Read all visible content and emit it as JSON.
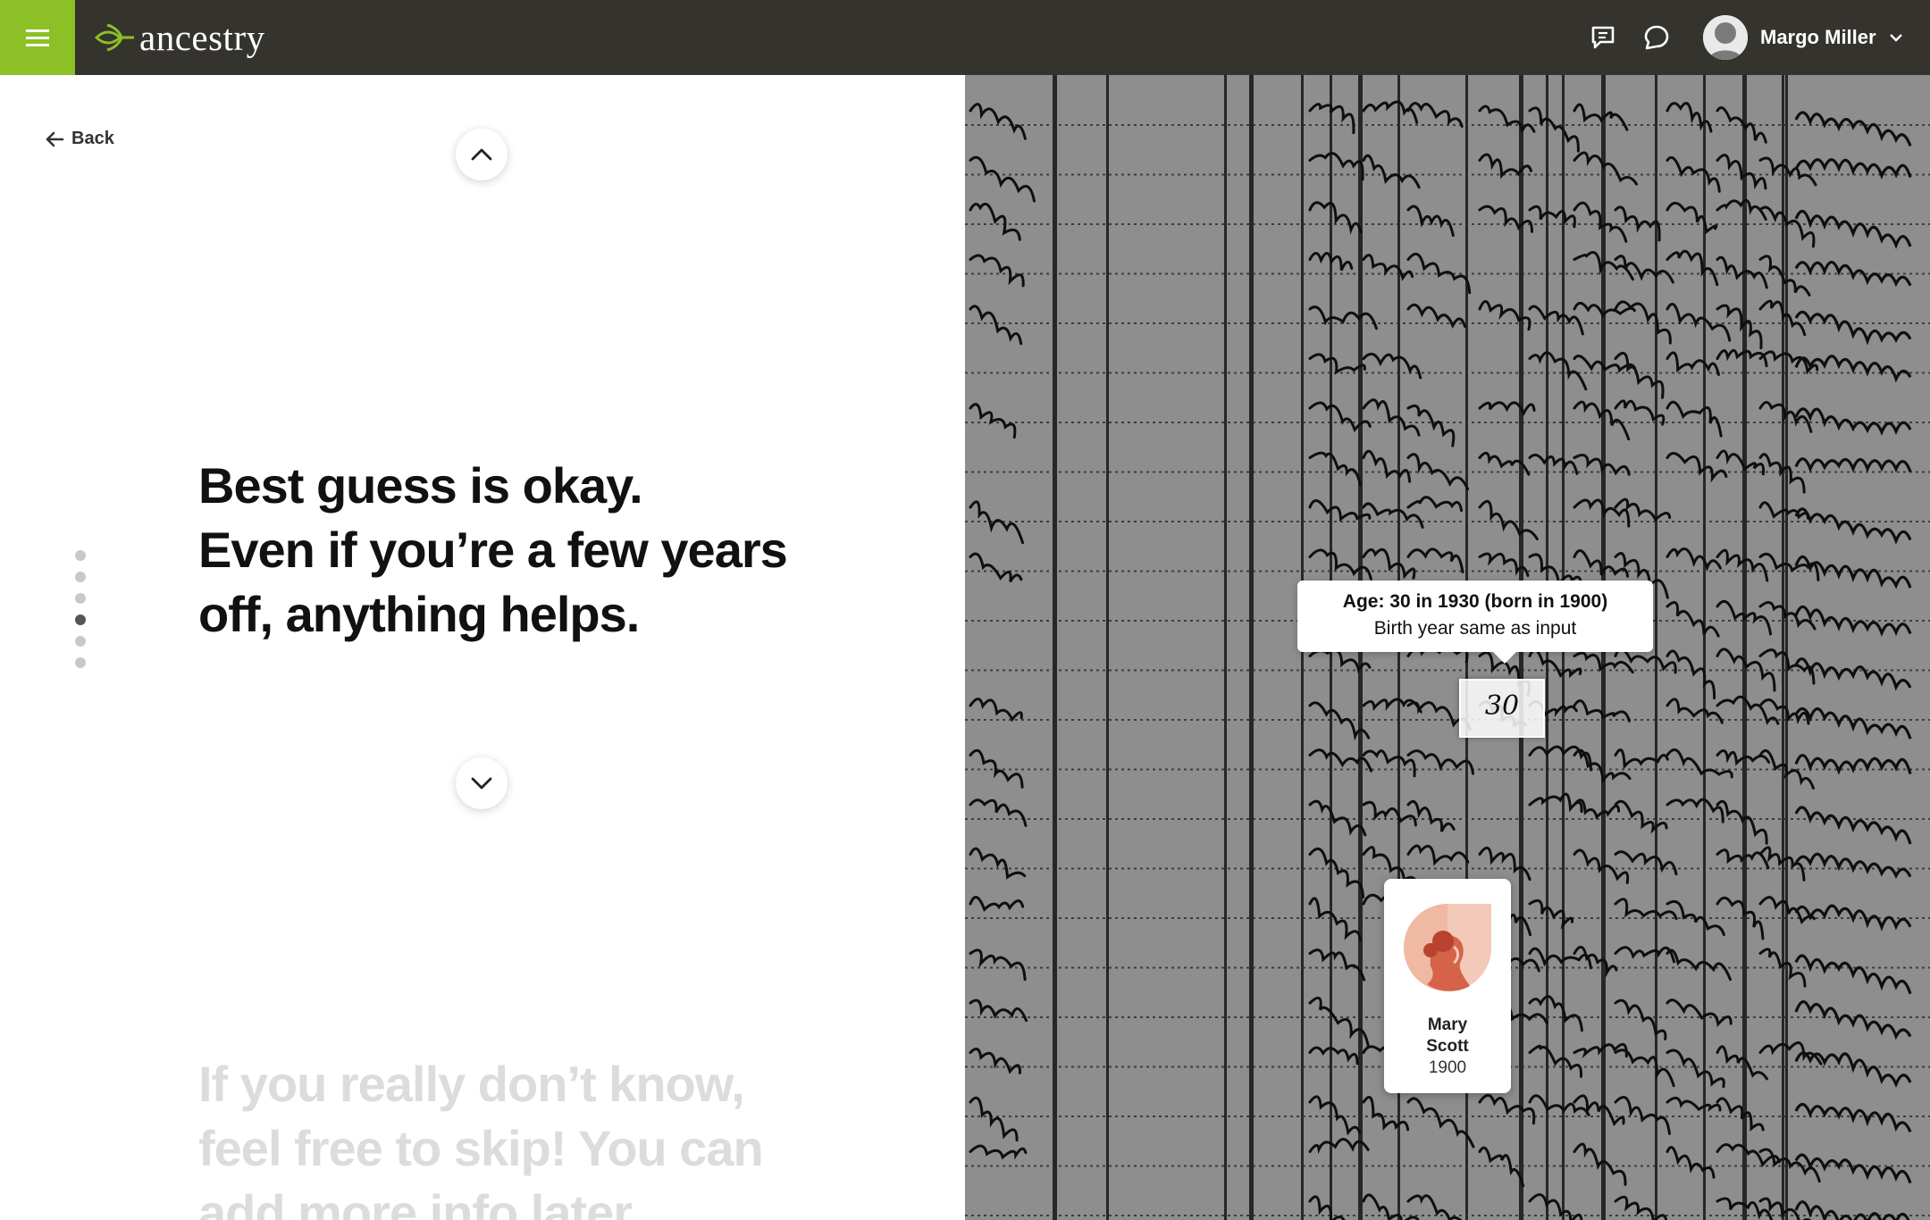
{
  "header": {
    "logo_text": "ancestry",
    "menu_icon": "hamburger-icon",
    "message_icon": "message-icon",
    "chat_icon": "chat-bubble-icon",
    "user_name": "Margo Miller",
    "user_menu_icon": "chevron-down-icon",
    "brand_color": "#8dbf26",
    "bar_color": "#35332e"
  },
  "nav": {
    "back_label": "Back"
  },
  "steps": {
    "count": 6,
    "active_index": 3
  },
  "content": {
    "headline_lines": [
      "Best guess is okay.",
      "Even if you’re a few years",
      "off, anything helps."
    ],
    "next_lines": [
      "If you really don’t know,",
      "feel free to skip! You can",
      "add more info later."
    ]
  },
  "record": {
    "tooltip_title": "Age: 30 in 1930 (born in 1900)",
    "tooltip_subtitle": "Birth year same as input",
    "highlight_value": "30",
    "person": {
      "first_name": "Mary",
      "last_name": "Scott",
      "birth_year": "1900"
    }
  }
}
